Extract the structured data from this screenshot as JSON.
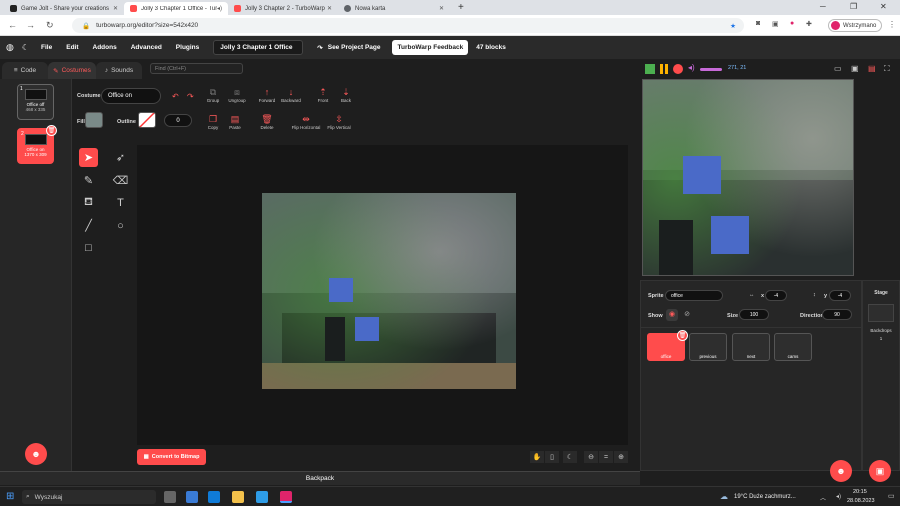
{
  "browser": {
    "tabs": [
      {
        "title": "Game Jolt - Share your creations",
        "color": "#1d1d1d"
      },
      {
        "title": "Jolly 3 Chapter 1 Office - Tur",
        "color": "#ff4c4c"
      },
      {
        "title": "Jolly 3 Chapter 2 - TurboWarp",
        "color": "#ff4c4c"
      },
      {
        "title": "Nowa karta",
        "color": "#5f6368"
      }
    ],
    "url": "turbowarp.org/editor?size=542x420",
    "profile": "Wstrzymano"
  },
  "menu": {
    "items": [
      "File",
      "Edit",
      "Addons",
      "Advanced",
      "Plugins"
    ],
    "project_title": "Jolly 3 Chapter 1 Office",
    "see_project": "See Project Page",
    "feedback": "TurboWarp Feedback",
    "blocks": "47 blocks"
  },
  "editor_tabs": {
    "code": "Code",
    "costumes": "Costumes",
    "sounds": "Sounds",
    "find": "Find (Ctrl+F)"
  },
  "costumes": [
    {
      "num": "1",
      "name": "Office off",
      "size": "468 x 335"
    },
    {
      "num": "2",
      "name": "Office on",
      "size": "1370 x 309"
    }
  ],
  "paint": {
    "costume_label": "Costume",
    "costume_name": "Office on",
    "fill_label": "Fill",
    "outline_label": "Outline",
    "outline_width": "0",
    "toolbar_top": [
      "Group",
      "Ungroup",
      "Forward",
      "Backward",
      "Front",
      "Back"
    ],
    "toolbar_bottom": [
      "Copy",
      "Paste",
      "Delete",
      "Flip Horizontal",
      "Flip Vertical"
    ],
    "convert": "Convert to Bitmap"
  },
  "stage_header": {
    "mouse": "271, 21"
  },
  "sprite": {
    "sprite_label": "Sprite",
    "sprite_name": "office",
    "x_label": "x",
    "x": "-4",
    "y_label": "y",
    "y": "-4",
    "show_label": "Show",
    "size_label": "Size",
    "size": "100",
    "direction_label": "Direction",
    "direction": "90",
    "sprites": [
      "office",
      "previous",
      "next",
      "cams"
    ]
  },
  "stage_panel": {
    "title": "Stage",
    "backdrops_label": "Backdrops",
    "backdrops": "1"
  },
  "backpack": "Backpack",
  "taskbar": {
    "search": "Wyszukaj",
    "weather": "19°C  Duże zachmurz...",
    "time": "20:15",
    "date": "28.08.2023"
  },
  "colors": {
    "accent": "#ff4c4c",
    "turbowarp_bg": "#1e1e1e"
  }
}
